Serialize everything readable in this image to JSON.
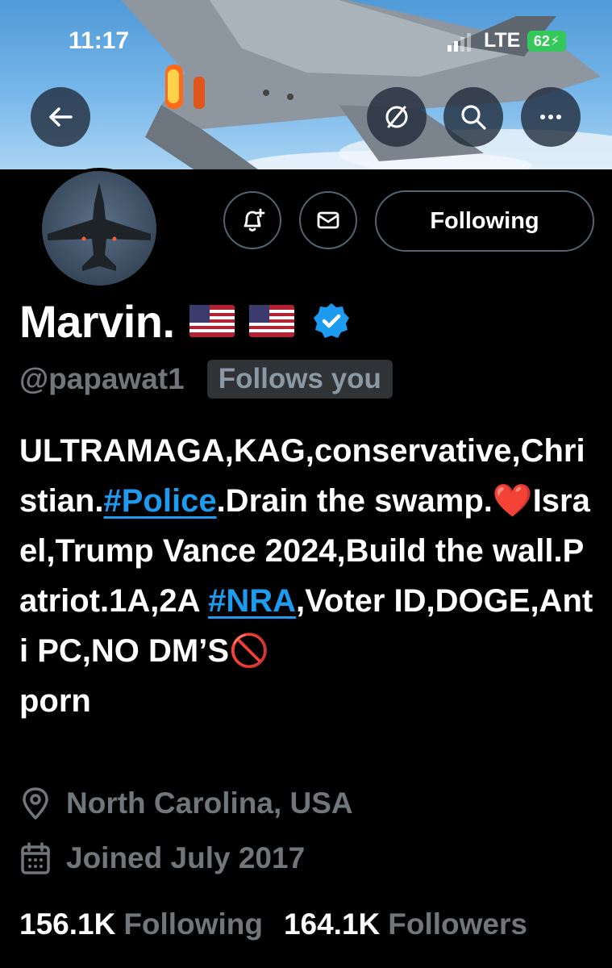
{
  "status_bar": {
    "time": "11:17",
    "network": "LTE",
    "battery": "62"
  },
  "header": {
    "back_icon": "arrow-left-icon",
    "hide_icon": "eye-slash-icon",
    "search_icon": "search-icon",
    "more_icon": "more-horizontal-icon"
  },
  "actions": {
    "notify_icon": "bell-plus-icon",
    "message_icon": "envelope-icon",
    "following_label": "Following"
  },
  "profile": {
    "name": "Marvin.",
    "flags": [
      "🇺🇸",
      "🇺🇸"
    ],
    "handle": "@papawat1",
    "follows_you": "Follows you",
    "bio_parts": [
      "ULTRAMAGA,KAG,conservative,Christian.",
      "#Police",
      ".Drain the swamp.",
      "❤️",
      "Israel,Trump Vance 2024,Build the wall.Patriot.1A,2A ",
      "#NRA",
      ",Voter ID,DOGE,Anti PC,NO DM’S",
      "🚫",
      "porn"
    ],
    "location": "North Carolina, USA",
    "joined": "Joined July 2017"
  },
  "stats": {
    "following_count": "156.1K",
    "following_label": "Following",
    "followers_count": "164.1K",
    "followers_label": "Followers"
  },
  "colors": {
    "accent": "#1d9bf0",
    "background": "#000000",
    "muted": "#71767b",
    "battery": "#34c759"
  }
}
